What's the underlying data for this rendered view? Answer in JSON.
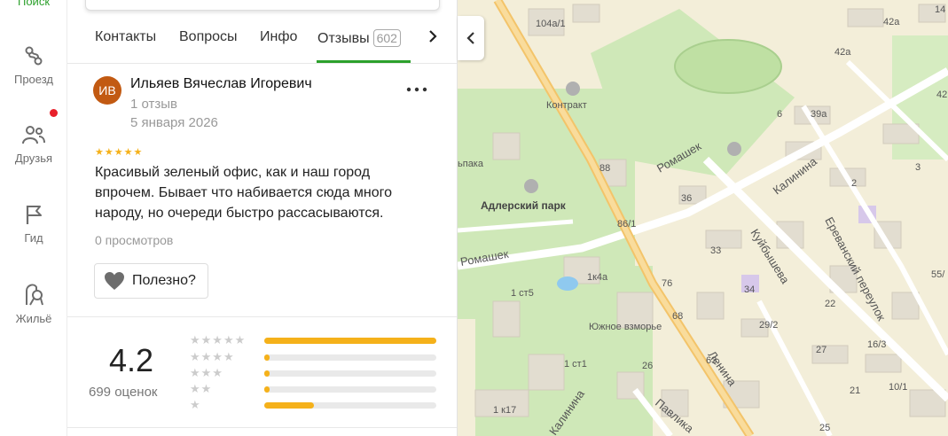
{
  "nav": {
    "top_label": "Поиск",
    "items": [
      {
        "label": "Проезд",
        "icon": "route-icon"
      },
      {
        "label": "Друзья",
        "icon": "friends-icon"
      },
      {
        "label": "Гид",
        "icon": "flag-icon"
      },
      {
        "label": "Жильё",
        "icon": "housing-icon"
      }
    ]
  },
  "tabs": {
    "items": [
      "Контакты",
      "Вопросы",
      "Инфо",
      "Отзывы"
    ],
    "reviews_count": "602",
    "active": "Отзывы"
  },
  "review": {
    "avatar_initials": "ИВ",
    "author": "Ильяев Вячеслав Игоревич",
    "reviews_count": "1 отзыв",
    "date": "5 января 2026",
    "stars": 5,
    "text": "Красивый зеленый офис, как и наш город впрочем. Бывает что набивается сюда много народу, но очереди быстро рассасываются.",
    "views": "0 просмотров",
    "useful_label": "Полезно?"
  },
  "rating": {
    "value": "4.2",
    "count": "699 оценок",
    "distribution": [
      {
        "stars": 5,
        "fraction": 1.0
      },
      {
        "stars": 4,
        "fraction": 0.03
      },
      {
        "stars": 3,
        "fraction": 0.03
      },
      {
        "stars": 2,
        "fraction": 0.03
      },
      {
        "stars": 1,
        "fraction": 0.29
      }
    ]
  },
  "colors": {
    "accent": "#2ca02c",
    "star": "#f5b11a",
    "notification": "#e8202a",
    "avatar": "#c25a12"
  },
  "map": {
    "labels": [
      "104а/1",
      "42а",
      "42а",
      "Контракт",
      "6",
      "39а",
      "Ромашек",
      "Калинина",
      "2",
      "3",
      "88",
      "36",
      "Адлерский парк",
      "86/1",
      "Ромашек",
      "1к4а",
      "1 ст5",
      "33",
      "34",
      "Ереванский переулок",
      "Куйбышева",
      "76",
      "55/",
      "68",
      "22",
      "Южное взморье",
      "29/2",
      "16/3",
      "27",
      "1 ст1",
      "26",
      "63",
      "Ленина",
      "21",
      "10/1",
      "1 к17",
      "Калинина",
      "Павлика",
      "25",
      "ьпака",
      "42",
      "14"
    ]
  }
}
